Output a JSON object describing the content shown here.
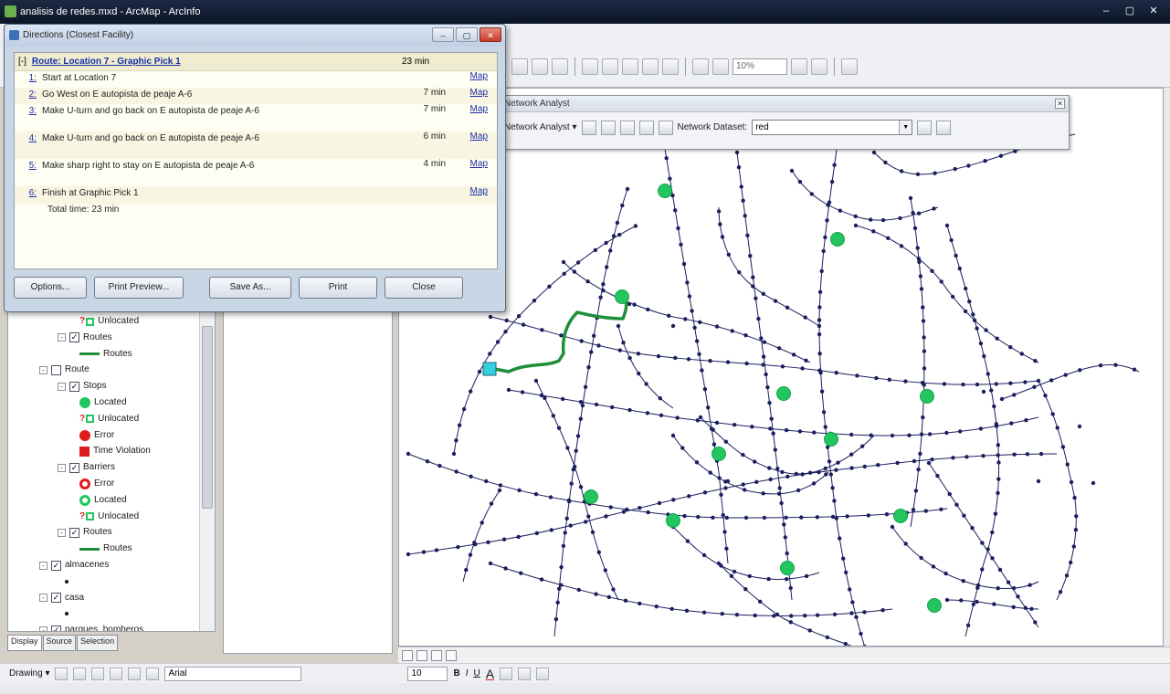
{
  "window": {
    "title": "analisis de redes.mxd - ArcMap - ArcInfo",
    "controls": [
      "–",
      "▢",
      "✕"
    ]
  },
  "main_toolbar": {
    "zoom_value": "10%"
  },
  "directions": {
    "title": "Directions (Closest Facility)",
    "route": {
      "expand": "[-]",
      "name": "Route: Location 7 - Graphic Pick 1",
      "time": "23 min"
    },
    "steps": [
      {
        "num": "1:",
        "text": "Start at Location 7",
        "time": "",
        "map": "Map"
      },
      {
        "num": "2:",
        "text": "Go West on E autopista de peaje A-6",
        "time": "7 min",
        "map": "Map"
      },
      {
        "num": "3:",
        "text": "Make U-turn and go back on E autopista de peaje A-6",
        "time": "7 min",
        "map": "Map"
      },
      {
        "num": "4:",
        "text": "Make U-turn and go back on E autopista de peaje A-6",
        "time": "6 min",
        "map": "Map"
      },
      {
        "num": "5:",
        "text": "Make sharp right to stay on E autopista de peaje A-6",
        "time": "4 min",
        "map": "Map"
      },
      {
        "num": "6:",
        "text": "Finish at Graphic Pick 1",
        "time": "",
        "map": "Map"
      }
    ],
    "total": "Total time: 23 min",
    "buttons": [
      "Options...",
      "Print Preview...",
      "Save As...",
      "Print",
      "Close"
    ]
  },
  "network_analyst": {
    "title": "Network Analyst",
    "menu_label": "Network Analyst ▾",
    "dataset_label": "Network Dataset:",
    "dataset_value": "red"
  },
  "toc": {
    "items": [
      {
        "label": "Unlocated",
        "symbol": "unlocated"
      },
      {
        "label": "Routes",
        "symbol": "check",
        "expand": "-"
      },
      {
        "label": "Routes",
        "symbol": "line"
      },
      {
        "label": "Route",
        "symbol": "check-empty",
        "expand": "-"
      },
      {
        "label": "Stops",
        "symbol": "check",
        "expand": "-"
      },
      {
        "label": "Located",
        "symbol": "green-dot"
      },
      {
        "label": "Unlocated",
        "symbol": "unlocated"
      },
      {
        "label": "Error",
        "symbol": "red-dot"
      },
      {
        "label": "Time Violation",
        "symbol": "red-square"
      },
      {
        "label": "Barriers",
        "symbol": "check",
        "expand": "-"
      },
      {
        "label": "Error",
        "symbol": "red-ring"
      },
      {
        "label": "Located",
        "symbol": "green-ring"
      },
      {
        "label": "Unlocated",
        "symbol": "unlocated"
      },
      {
        "label": "Routes",
        "symbol": "check",
        "expand": "-"
      },
      {
        "label": "Routes",
        "symbol": "line"
      },
      {
        "label": "almacenes",
        "symbol": "check",
        "expand": "-"
      },
      {
        "label": "",
        "symbol": "small-dot"
      },
      {
        "label": "casa",
        "symbol": "check",
        "expand": "-"
      },
      {
        "label": "",
        "symbol": "small-dot"
      },
      {
        "label": "parques_bomberos",
        "symbol": "check",
        "expand": "-"
      }
    ],
    "tabs": [
      "Display",
      "Source",
      "Selection"
    ]
  },
  "drawing_toolbar": {
    "label": "Drawing ▾",
    "font_name": "Arial",
    "font_size": "10",
    "bold": "B",
    "italic": "I",
    "underline": "U",
    "font_color": "A"
  },
  "map": {
    "facility_color": "#22c55e",
    "route_color": "#1f8f3a",
    "network_color": "#1b1f5e",
    "incident_color": "#35d0e0"
  }
}
